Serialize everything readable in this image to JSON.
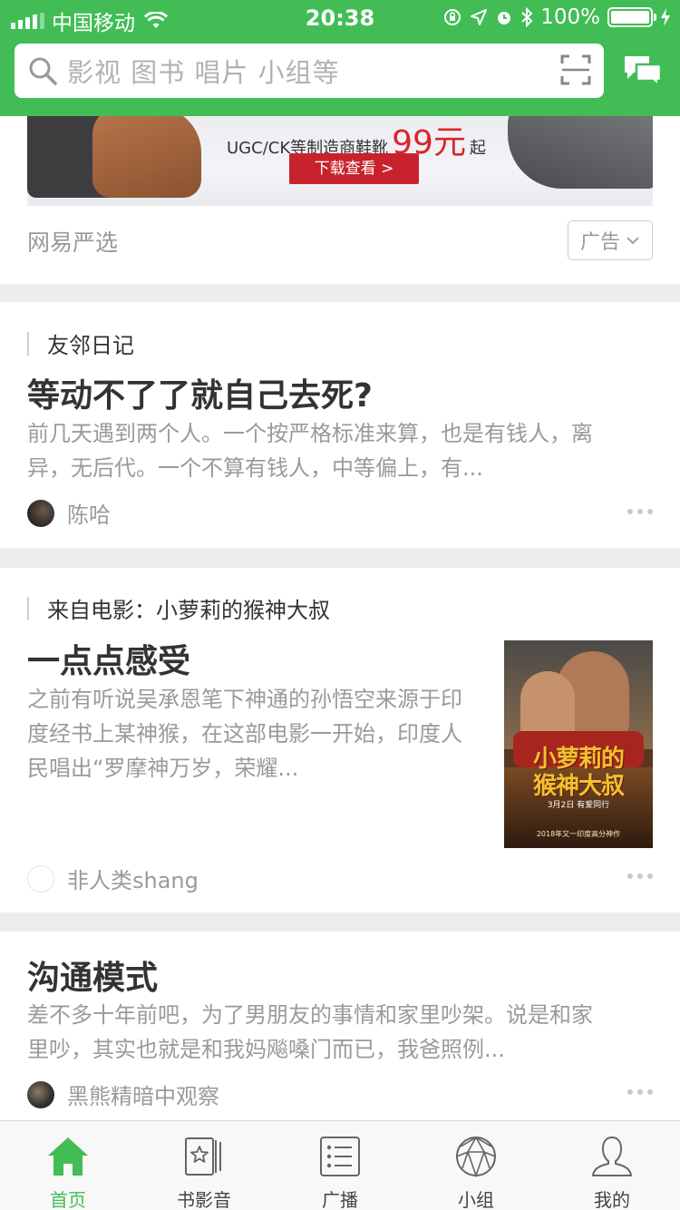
{
  "status_bar": {
    "carrier": "中国移动",
    "time": "20:38",
    "battery": "100%"
  },
  "header": {
    "search_placeholder": "影视 图书 唱片 小组等"
  },
  "ad": {
    "banner_text": "UGC/CK等制造商鞋靴",
    "price": "99元",
    "price_suffix": "起",
    "button": "下载查看 >",
    "source": "网易严选",
    "tag": "广告"
  },
  "posts": [
    {
      "source": "友邻日记",
      "title": "等动不了了就自己去死?",
      "excerpt": "前几天遇到两个人。一个按严格标准来算，也是有钱人，离异，无后代。一个不算有钱人，中等偏上，有...",
      "author": "陈哈"
    },
    {
      "source": "来自电影：小萝莉的猴神大叔",
      "title": "一点点感受",
      "excerpt": "之前有听说吴承恩笔下神通的孙悟空来源于印度经书上某神猴，在这部电影一开始，印度人民唱出“罗摩神万岁，荣耀...",
      "author": "非人类shang",
      "poster": {
        "title_line1": "小萝莉的",
        "title_line2": "猴神大叔",
        "date": "3月2日 有爱同行",
        "footer": "2018年又一印度高分神作"
      }
    },
    {
      "title": "沟通模式",
      "excerpt": "差不多十年前吧，为了男朋友的事情和家里吵架。说是和家里吵，其实也就是和我妈飚嗓门而已，我爸照例...",
      "author": "黑熊精暗中观察"
    }
  ],
  "tabs": [
    {
      "label": "首页",
      "icon": "home-icon",
      "active": true
    },
    {
      "label": "书影音",
      "icon": "book-film-music-icon",
      "active": false
    },
    {
      "label": "广播",
      "icon": "broadcast-icon",
      "active": false
    },
    {
      "label": "小组",
      "icon": "group-icon",
      "active": false
    },
    {
      "label": "我的",
      "icon": "profile-icon",
      "active": false
    }
  ],
  "colors": {
    "brand_green": "#42bd56",
    "price_red": "#d8262e",
    "muted_text": "#9a9a9a"
  }
}
